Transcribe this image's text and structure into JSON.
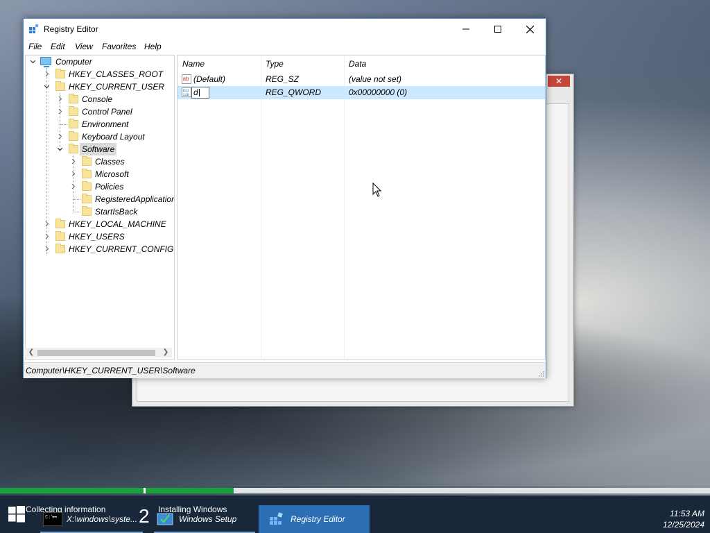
{
  "window": {
    "title": "Registry Editor",
    "menu": [
      "File",
      "Edit",
      "View",
      "Favorites",
      "Help"
    ]
  },
  "tree": {
    "root": "Computer",
    "items": [
      {
        "label": "HKEY_CLASSES_ROOT"
      },
      {
        "label": "HKEY_CURRENT_USER"
      },
      {
        "label": "Console"
      },
      {
        "label": "Control Panel"
      },
      {
        "label": "Environment"
      },
      {
        "label": "Keyboard Layout"
      },
      {
        "label": "Software"
      },
      {
        "label": "Classes"
      },
      {
        "label": "Microsoft"
      },
      {
        "label": "Policies"
      },
      {
        "label": "RegisteredApplicatior"
      },
      {
        "label": "StartIsBack"
      },
      {
        "label": "HKEY_LOCAL_MACHINE"
      },
      {
        "label": "HKEY_USERS"
      },
      {
        "label": "HKEY_CURRENT_CONFIG"
      }
    ]
  },
  "list": {
    "columns": [
      "Name",
      "Type",
      "Data"
    ],
    "rows": [
      {
        "name": "(Default)",
        "type": "REG_SZ",
        "data": "(value not set)"
      },
      {
        "name": "d",
        "type": "REG_QWORD",
        "data": "0x00000000 (0)"
      }
    ]
  },
  "statusbar": {
    "path": "Computer\\HKEY_CURRENT_USER\\Software"
  },
  "setup": {
    "phase1_label": "Collecting information",
    "phase2_number": "2",
    "phase2_label": "Installing Windows",
    "colors": {
      "progress": "#18a23b",
      "taskbar": "#18283a",
      "active_task": "#2c6fb4"
    }
  },
  "taskbar": {
    "tasks": [
      {
        "label": "X:\\windows\\syste..."
      },
      {
        "label": "Windows Setup"
      },
      {
        "label": "Registry Editor"
      }
    ],
    "time": "11:53 AM",
    "date": "12/25/2024"
  }
}
